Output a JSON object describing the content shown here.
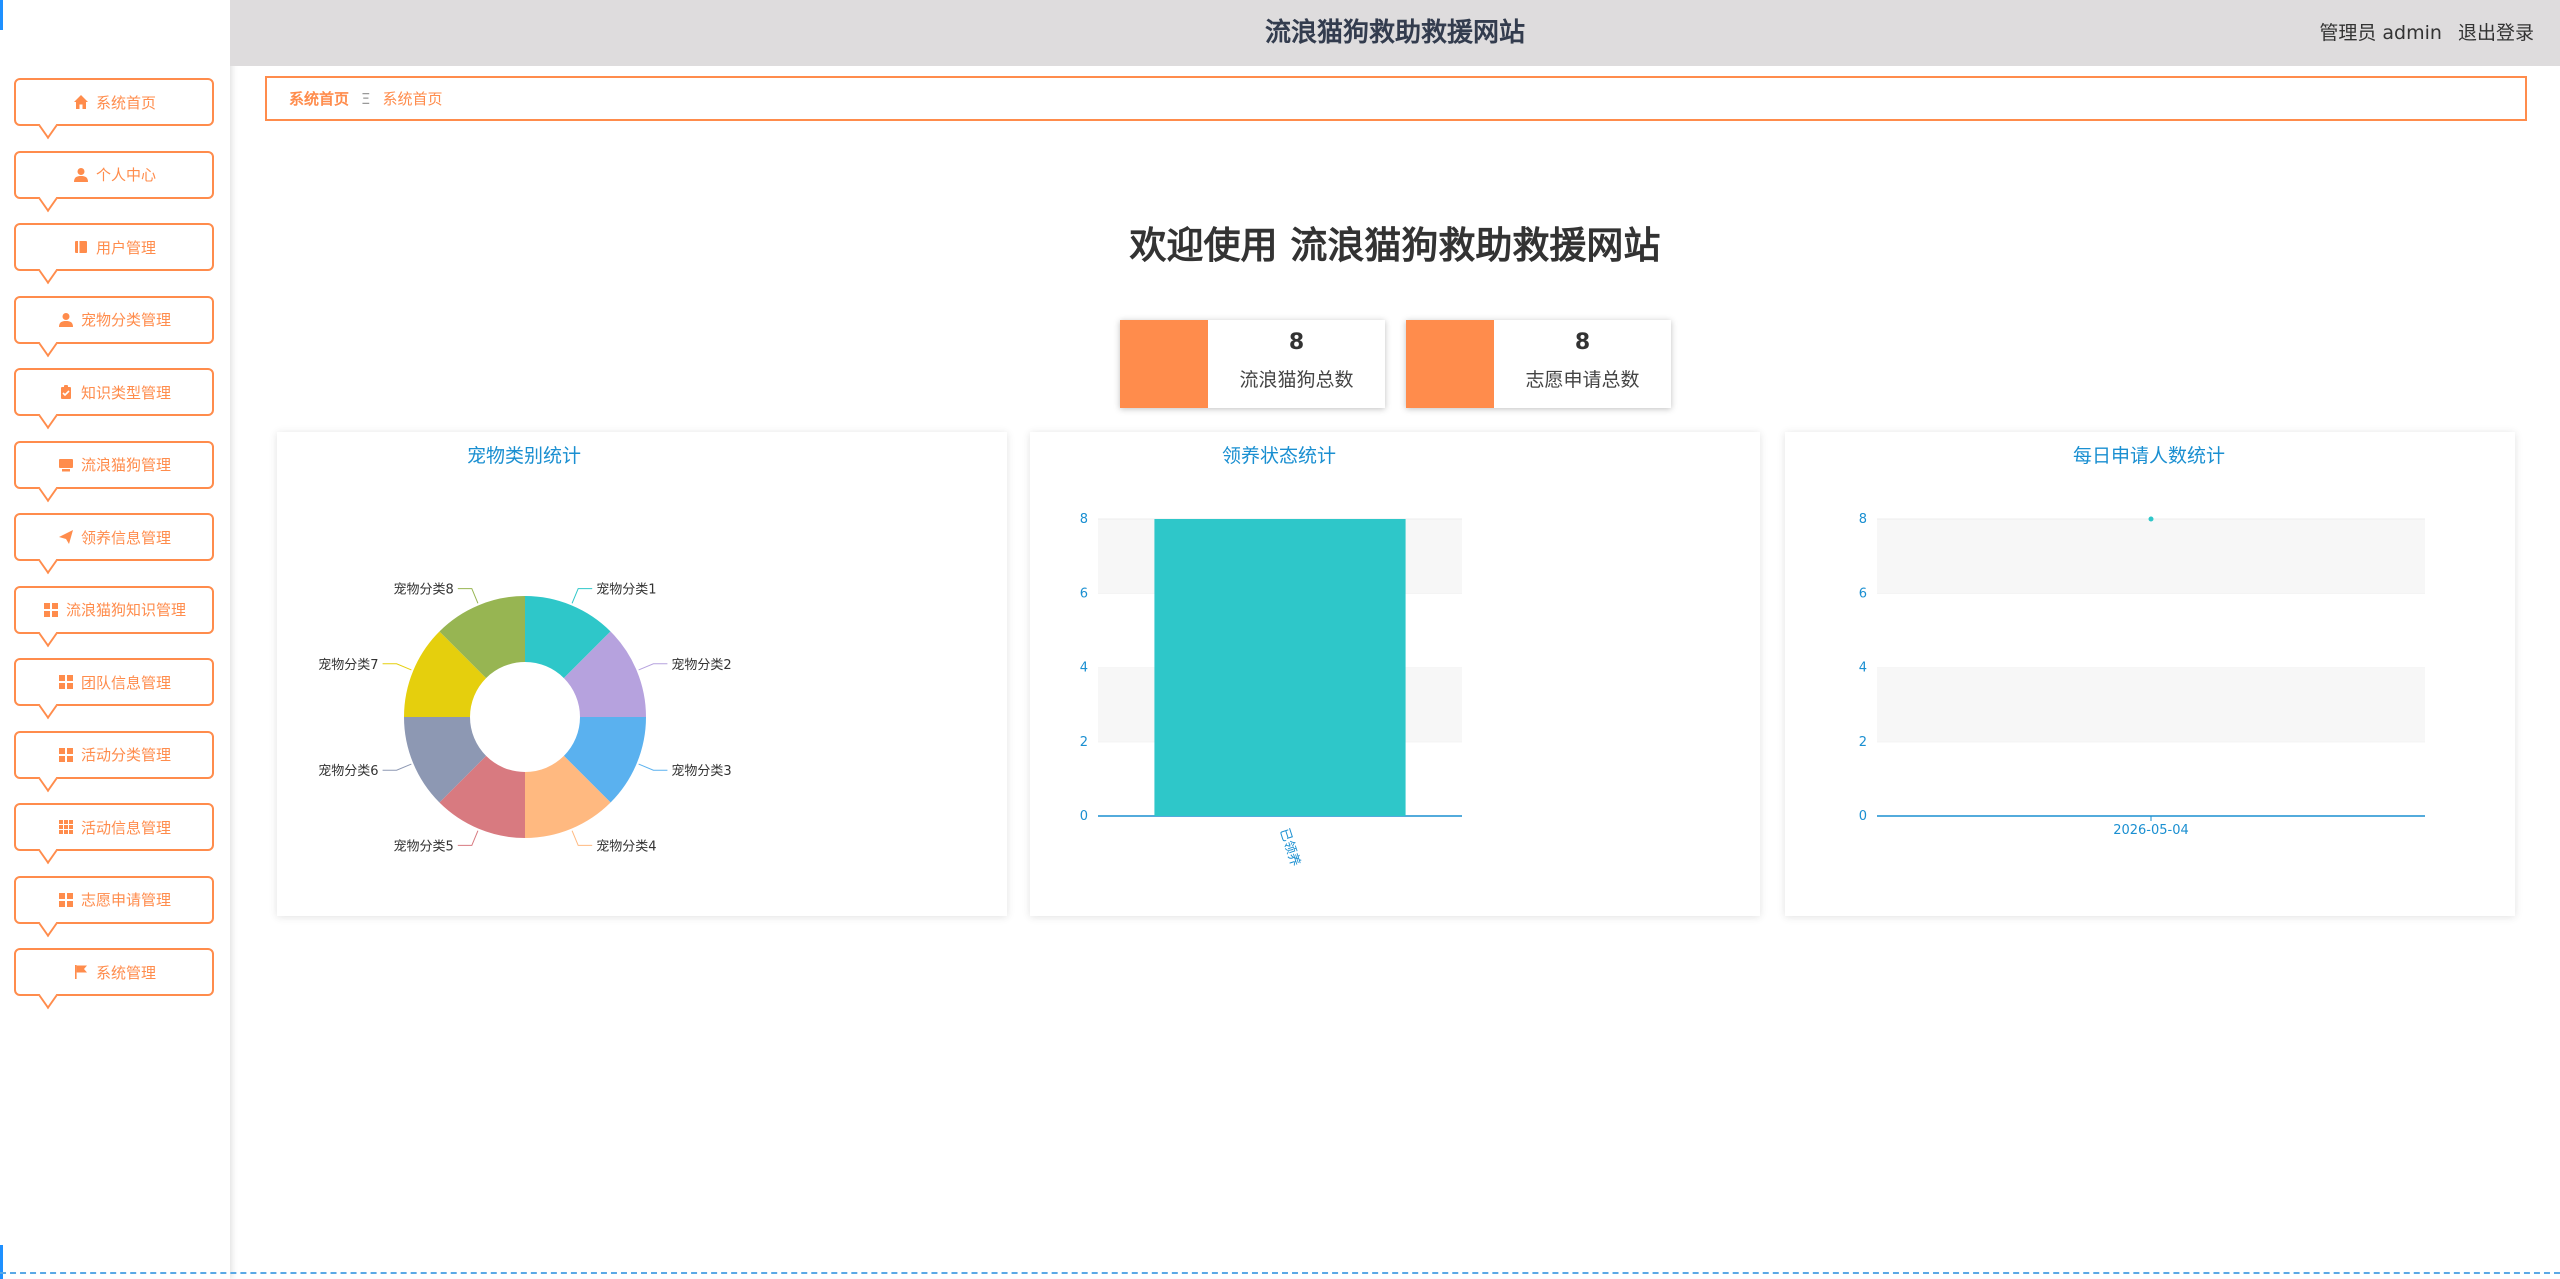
{
  "header": {
    "title": "流浪猫狗救助救援网站",
    "user_label": "管理员 admin",
    "logout": "退出登录"
  },
  "sidebar": {
    "items": [
      {
        "label": "系统首页",
        "icon": "home-icon"
      },
      {
        "label": "个人中心",
        "icon": "user-icon"
      },
      {
        "label": "用户管理",
        "icon": "book-icon"
      },
      {
        "label": "宠物分类管理",
        "icon": "user-icon"
      },
      {
        "label": "知识类型管理",
        "icon": "clipboard-icon"
      },
      {
        "label": "流浪猫狗管理",
        "icon": "monitor-icon"
      },
      {
        "label": "领养信息管理",
        "icon": "send-icon"
      },
      {
        "label": "流浪猫狗知识管理",
        "icon": "grid-icon"
      },
      {
        "label": "团队信息管理",
        "icon": "grid-icon"
      },
      {
        "label": "活动分类管理",
        "icon": "grid-icon"
      },
      {
        "label": "活动信息管理",
        "icon": "apps-icon"
      },
      {
        "label": "志愿申请管理",
        "icon": "grid-icon"
      },
      {
        "label": "系统管理",
        "icon": "flag-icon"
      }
    ]
  },
  "breadcrumb": {
    "items": [
      "系统首页",
      "系统首页"
    ],
    "separator": "Ξ"
  },
  "welcome": "欢迎使用 流浪猫狗救助救援网站",
  "stats": [
    {
      "value": "8",
      "label": "流浪猫狗总数"
    },
    {
      "value": "8",
      "label": "志愿申请总数"
    }
  ],
  "colors": {
    "accent": "#ff8c4c",
    "chart_text": "#1a8fd1",
    "bar": "#2ec7c9"
  },
  "chart_data": [
    {
      "type": "pie",
      "title": "宠物类别统计",
      "categories": [
        "宠物分类1",
        "宠物分类2",
        "宠物分类3",
        "宠物分类4",
        "宠物分类5",
        "宠物分类6",
        "宠物分类7",
        "宠物分类8"
      ],
      "values": [
        1,
        1,
        1,
        1,
        1,
        1,
        1,
        1
      ],
      "colors": [
        "#2ec7c9",
        "#b6a2de",
        "#5ab1ef",
        "#ffb980",
        "#d87a80",
        "#8d98b3",
        "#e5cf0d",
        "#97b552"
      ],
      "donut": true
    },
    {
      "type": "bar",
      "title": "领养状态统计",
      "categories": [
        "已领养"
      ],
      "values": [
        8
      ],
      "ylim": [
        0,
        8
      ],
      "yticks": [
        0,
        2,
        4,
        6,
        8
      ],
      "grid": true
    },
    {
      "type": "scatter",
      "title": "每日申请人数统计",
      "categories": [
        "2026-05-04"
      ],
      "values": [
        8
      ],
      "ylim": [
        0,
        8
      ],
      "yticks": [
        0,
        2,
        4,
        6,
        8
      ],
      "grid": true
    }
  ]
}
